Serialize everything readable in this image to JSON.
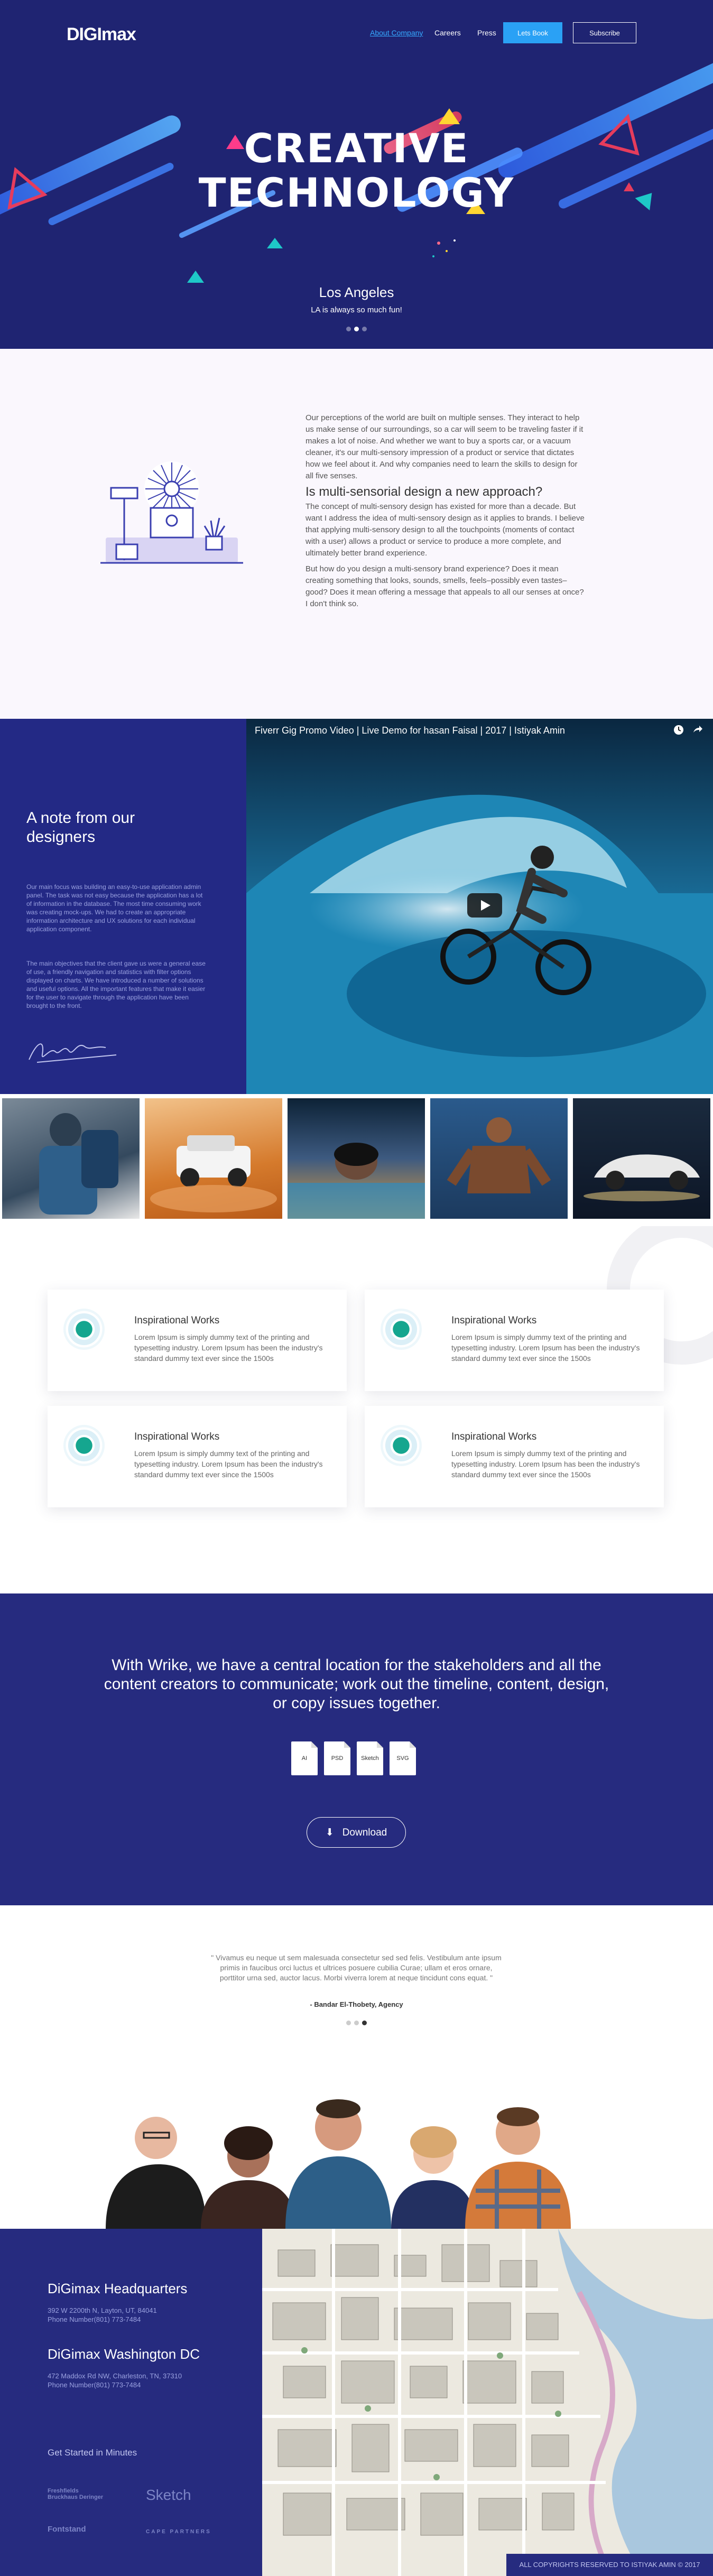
{
  "nav": {
    "logo": "DIGImax",
    "links": [
      "About Company",
      "Careers",
      "Press"
    ],
    "book_label": "Lets Book",
    "subscribe_label": "Subscribe"
  },
  "hero": {
    "title_line1": "CREATIVE",
    "title_line2": "TECHNOLOGY",
    "city": "Los Angeles",
    "tagline": "LA is always so much fun!",
    "slides": 3,
    "active_slide": 1
  },
  "about": {
    "p1": "Our perceptions of the world are built on multiple senses. They interact to help us make sense of our surroundings, so a car will seem to be traveling faster if it makes a lot of noise. And whether we want to buy a sports car, or a vacuum cleaner, it's our multi-sensory impression of a product or service that dictates how we feel about it. And why companies need to learn the skills to design for all five senses.",
    "heading": "Is multi-sensorial design a new approach?",
    "p2": "The concept of multi-sensory design has existed for more than a decade. But want I address the idea of multi-sensory design as it applies to brands. I believe that applying multi-sensory design to all the touchpoints (moments of contact with a user) allows a product or service to produce a more complete, and ultimately better brand experience.",
    "p3": "But how do you design a multi-sensory brand experience? Does it mean creating something that looks, sounds, smells, feels–possibly even tastes–good? Does it mean offering a message that appeals to all our senses at once? I don't think so."
  },
  "designers": {
    "title": "A note from our designers",
    "p1": "Our main focus was building an easy-to-use application admin panel. The task was not easy because the application has a lot of information in the database. The most time consuming work was creating mock-ups. We had to create an appropriate information architecture and UX solutions for each individual application component.",
    "p2": "The main objectives that the client gave us were a general ease of use, a friendly navigation and statistics with filter options displayed on charts. We have introduced a number of solutions and useful options. All the important features that make it easier for the user to navigate through the application have been brought to the front."
  },
  "video": {
    "title": "Fiverr Gig Promo Video | Live Demo for hasan Faisal | 2017 | Istiyak Amin"
  },
  "features": [
    {
      "title": "Inspirational Works",
      "text": "Lorem Ipsum is simply dummy text of the printing and typesetting industry. Lorem Ipsum has been the industry's standard dummy text ever since the 1500s"
    },
    {
      "title": "Inspirational Works",
      "text": "Lorem Ipsum is simply dummy text of the printing and typesetting industry. Lorem Ipsum has been the industry's standard dummy text ever since the 1500s"
    },
    {
      "title": "Inspirational Works",
      "text": "Lorem Ipsum is simply dummy text of the printing and typesetting industry. Lorem Ipsum has been the industry's standard dummy text ever since the 1500s"
    },
    {
      "title": "Inspirational Works",
      "text": "Lorem Ipsum is simply dummy text of the printing and typesetting industry. Lorem Ipsum has been the industry's standard dummy text ever since the 1500s"
    }
  ],
  "cta": {
    "heading": "With Wrike, we have a central location for the stakeholders and all the content creators to communicate; work out the timeline, content, design, or copy issues together.",
    "files": [
      "AI",
      "PSD",
      "Sketch",
      "SVG"
    ],
    "download_label": "Download"
  },
  "testimonial": {
    "quote": "\" Vivamus eu neque ut sem malesuada consectetur sed sed felis. Vestibulum ante ipsum primis in faucibus orci luctus et ultrices posuere cubilia Curae; ullam et eros ornare, porttitor urna sed, auctor lacus. Morbi viverra lorem at neque tincidunt cons equat. \"",
    "author": "- Bandar El-Thobety, Agency",
    "slides": 3,
    "active_slide": 3
  },
  "footer": {
    "hq_title": "DiGimax Headquarters",
    "hq_addr1": "392 W 2200th N, Layton, UT, 84041",
    "hq_phone": "Phone Number(801) 773-7484",
    "dc_title": "DiGimax Washington DC",
    "dc_addr1": "472 Maddox Rd NW, Charleston, TN, 37310",
    "dc_phone": "Phone Number(801) 773-7484",
    "started": "Get Started in Minutes",
    "brands": [
      "Freshfields Bruckhaus Deringer",
      "Sketch",
      "Fontstand",
      "CAPE PARTNERS"
    ],
    "copyright": "ALL COPYRIGHTS RESERVED TO ISTIYAK AMIN © 2017"
  },
  "colors": {
    "navy": "#1f2472",
    "navy_alt": "#262b7f",
    "accent_blue": "#2aa1f5",
    "accent_red": "#e63c5c",
    "accent_yellow": "#ffd632",
    "teal": "#15a68f"
  }
}
